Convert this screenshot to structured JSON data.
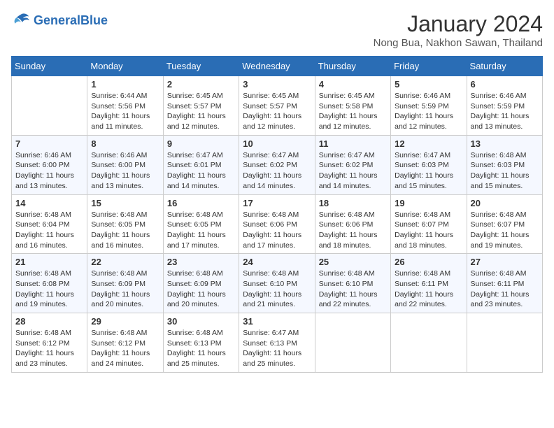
{
  "header": {
    "logo_line1": "General",
    "logo_line2": "Blue",
    "month": "January 2024",
    "location": "Nong Bua, Nakhon Sawan, Thailand"
  },
  "weekdays": [
    "Sunday",
    "Monday",
    "Tuesday",
    "Wednesday",
    "Thursday",
    "Friday",
    "Saturday"
  ],
  "weeks": [
    [
      {
        "day": "",
        "info": ""
      },
      {
        "day": "1",
        "info": "Sunrise: 6:44 AM\nSunset: 5:56 PM\nDaylight: 11 hours\nand 11 minutes."
      },
      {
        "day": "2",
        "info": "Sunrise: 6:45 AM\nSunset: 5:57 PM\nDaylight: 11 hours\nand 12 minutes."
      },
      {
        "day": "3",
        "info": "Sunrise: 6:45 AM\nSunset: 5:57 PM\nDaylight: 11 hours\nand 12 minutes."
      },
      {
        "day": "4",
        "info": "Sunrise: 6:45 AM\nSunset: 5:58 PM\nDaylight: 11 hours\nand 12 minutes."
      },
      {
        "day": "5",
        "info": "Sunrise: 6:46 AM\nSunset: 5:59 PM\nDaylight: 11 hours\nand 12 minutes."
      },
      {
        "day": "6",
        "info": "Sunrise: 6:46 AM\nSunset: 5:59 PM\nDaylight: 11 hours\nand 13 minutes."
      }
    ],
    [
      {
        "day": "7",
        "info": "Sunrise: 6:46 AM\nSunset: 6:00 PM\nDaylight: 11 hours\nand 13 minutes."
      },
      {
        "day": "8",
        "info": "Sunrise: 6:46 AM\nSunset: 6:00 PM\nDaylight: 11 hours\nand 13 minutes."
      },
      {
        "day": "9",
        "info": "Sunrise: 6:47 AM\nSunset: 6:01 PM\nDaylight: 11 hours\nand 14 minutes."
      },
      {
        "day": "10",
        "info": "Sunrise: 6:47 AM\nSunset: 6:02 PM\nDaylight: 11 hours\nand 14 minutes."
      },
      {
        "day": "11",
        "info": "Sunrise: 6:47 AM\nSunset: 6:02 PM\nDaylight: 11 hours\nand 14 minutes."
      },
      {
        "day": "12",
        "info": "Sunrise: 6:47 AM\nSunset: 6:03 PM\nDaylight: 11 hours\nand 15 minutes."
      },
      {
        "day": "13",
        "info": "Sunrise: 6:48 AM\nSunset: 6:03 PM\nDaylight: 11 hours\nand 15 minutes."
      }
    ],
    [
      {
        "day": "14",
        "info": "Sunrise: 6:48 AM\nSunset: 6:04 PM\nDaylight: 11 hours\nand 16 minutes."
      },
      {
        "day": "15",
        "info": "Sunrise: 6:48 AM\nSunset: 6:05 PM\nDaylight: 11 hours\nand 16 minutes."
      },
      {
        "day": "16",
        "info": "Sunrise: 6:48 AM\nSunset: 6:05 PM\nDaylight: 11 hours\nand 17 minutes."
      },
      {
        "day": "17",
        "info": "Sunrise: 6:48 AM\nSunset: 6:06 PM\nDaylight: 11 hours\nand 17 minutes."
      },
      {
        "day": "18",
        "info": "Sunrise: 6:48 AM\nSunset: 6:06 PM\nDaylight: 11 hours\nand 18 minutes."
      },
      {
        "day": "19",
        "info": "Sunrise: 6:48 AM\nSunset: 6:07 PM\nDaylight: 11 hours\nand 18 minutes."
      },
      {
        "day": "20",
        "info": "Sunrise: 6:48 AM\nSunset: 6:07 PM\nDaylight: 11 hours\nand 19 minutes."
      }
    ],
    [
      {
        "day": "21",
        "info": "Sunrise: 6:48 AM\nSunset: 6:08 PM\nDaylight: 11 hours\nand 19 minutes."
      },
      {
        "day": "22",
        "info": "Sunrise: 6:48 AM\nSunset: 6:09 PM\nDaylight: 11 hours\nand 20 minutes."
      },
      {
        "day": "23",
        "info": "Sunrise: 6:48 AM\nSunset: 6:09 PM\nDaylight: 11 hours\nand 20 minutes."
      },
      {
        "day": "24",
        "info": "Sunrise: 6:48 AM\nSunset: 6:10 PM\nDaylight: 11 hours\nand 21 minutes."
      },
      {
        "day": "25",
        "info": "Sunrise: 6:48 AM\nSunset: 6:10 PM\nDaylight: 11 hours\nand 22 minutes."
      },
      {
        "day": "26",
        "info": "Sunrise: 6:48 AM\nSunset: 6:11 PM\nDaylight: 11 hours\nand 22 minutes."
      },
      {
        "day": "27",
        "info": "Sunrise: 6:48 AM\nSunset: 6:11 PM\nDaylight: 11 hours\nand 23 minutes."
      }
    ],
    [
      {
        "day": "28",
        "info": "Sunrise: 6:48 AM\nSunset: 6:12 PM\nDaylight: 11 hours\nand 23 minutes."
      },
      {
        "day": "29",
        "info": "Sunrise: 6:48 AM\nSunset: 6:12 PM\nDaylight: 11 hours\nand 24 minutes."
      },
      {
        "day": "30",
        "info": "Sunrise: 6:48 AM\nSunset: 6:13 PM\nDaylight: 11 hours\nand 25 minutes."
      },
      {
        "day": "31",
        "info": "Sunrise: 6:47 AM\nSunset: 6:13 PM\nDaylight: 11 hours\nand 25 minutes."
      },
      {
        "day": "",
        "info": ""
      },
      {
        "day": "",
        "info": ""
      },
      {
        "day": "",
        "info": ""
      }
    ]
  ]
}
